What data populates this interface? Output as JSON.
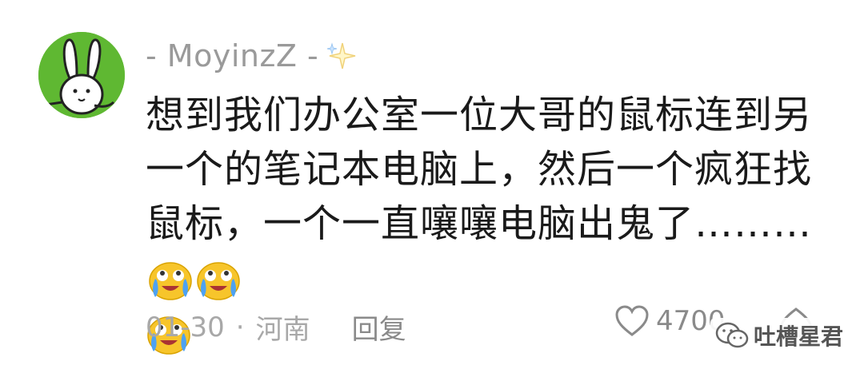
{
  "comment": {
    "username": "- MoyinzZ -",
    "text": "想到我们办公室一位大哥的鼠标连到另一个的笔记本电脑上，然后一个疯狂找鼠标，一个一直嚷嚷电脑出鬼了………",
    "emoji": [
      "laugh-cry-emoji",
      "laugh-cry-emoji",
      "laugh-cry-emoji"
    ],
    "date": "01-30",
    "separator": "·",
    "location": "河南",
    "reply_label": "回复",
    "like_count": "4700"
  },
  "watermark": {
    "text": "吐槽星君"
  },
  "colors": {
    "avatar_bg": "#5fb832",
    "meta_text": "#a8a8a8",
    "body_text": "#1a1a1a",
    "emoji_face": "#f7c52b",
    "emoji_tear": "#4ea2f2"
  }
}
